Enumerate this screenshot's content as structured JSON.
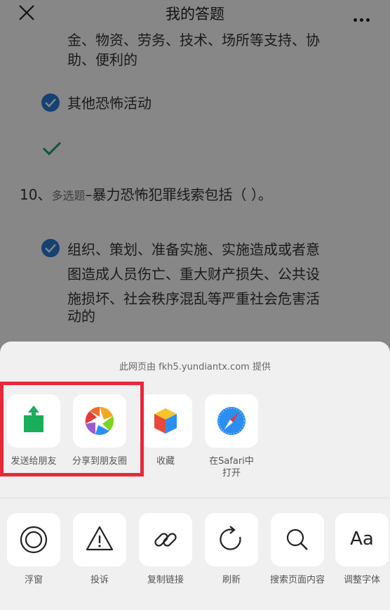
{
  "header": {
    "title": "我的答题"
  },
  "content": {
    "partial_line_1": "金、物资、劳务、技术、场所等支持、协",
    "partial_line_2": "助、便利的",
    "option_other": "其他恐怖活动",
    "question": {
      "number": "10、",
      "type": "多选题",
      "separator": "–",
      "text": "暴力恐怖犯罪线索包括（ ）。"
    },
    "option_lines": [
      "组织、策划、准备实施、实施造成或者意",
      "图造成人员伤亡、重大财产损失、公共设",
      "施损坏、社会秩序混乱等严重社会危害活",
      "动的"
    ]
  },
  "sheet": {
    "provider": "此网页由 fkh5.yundiantx.com 提供",
    "row1": [
      {
        "label": "发送给朋友",
        "icon": "share-upload-icon"
      },
      {
        "label": "分享到朋友圈",
        "icon": "moments-aperture-icon"
      },
      {
        "label": "收藏",
        "icon": "favorite-cube-icon"
      },
      {
        "label": "在Safari中",
        "label2": "打开",
        "icon": "safari-compass-icon"
      }
    ],
    "row2": [
      {
        "label": "浮窗",
        "icon": "float-window-icon"
      },
      {
        "label": "投诉",
        "icon": "warning-icon"
      },
      {
        "label": "复制链接",
        "icon": "link-icon"
      },
      {
        "label": "刷新",
        "icon": "refresh-icon"
      },
      {
        "label": "搜索页面内容",
        "icon": "search-icon"
      },
      {
        "label": "调整字体",
        "icon": "font-size-icon",
        "glyph": "Aa"
      }
    ]
  },
  "colors": {
    "check": "#2b7bd6",
    "highlight": "#e8283a",
    "share_green": "#1aad5c"
  }
}
